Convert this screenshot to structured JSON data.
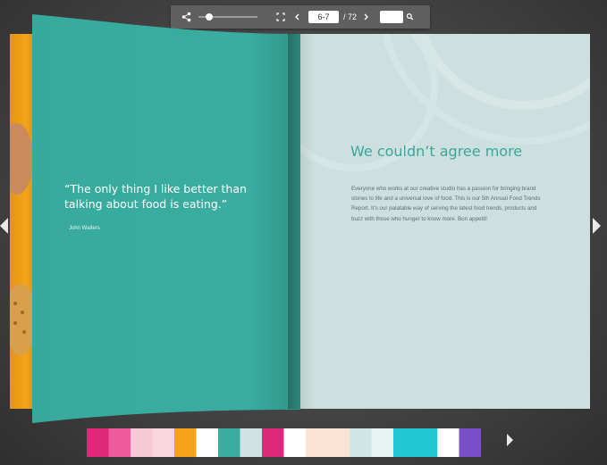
{
  "toolbar": {
    "share_icon": "share-icon",
    "zoom_slider_level": 0.12,
    "fullscreen_icon": "fullscreen-icon",
    "prev_icon": "chevron-left-icon",
    "page_value": "6-7",
    "total_pages": "/ 72",
    "next_icon": "chevron-right-icon",
    "search_value": "",
    "search_icon": "search-icon"
  },
  "left_page": {
    "quote": "“The only thing I like better than talking about food is eating.”",
    "author": "John Walters"
  },
  "right_page": {
    "heading": "We couldn’t agree more",
    "body": "Everyone who works at our creative studio has a passion for bringing brand stories to life and a universal love of food. This is our 5th Annual Food Trends Report. It’s our palatable way of serving the latest food trends, products and buzz with those who hunger to know more. Bon appetit!"
  },
  "colors": {
    "teal": "#3aada1",
    "mint_page": "#cde0df",
    "orange": "#f2a51a",
    "pink": "#e83e8c"
  },
  "thumbnails": [
    {
      "name": "thumb-1",
      "left": "#e0287a",
      "right": "#ee5a9a"
    },
    {
      "name": "thumb-2",
      "left": "#f6c9d6",
      "right": "#f9d6e0"
    },
    {
      "name": "thumb-3",
      "left": "#f3a21a",
      "right": "#ffffff"
    },
    {
      "name": "thumb-4",
      "left": "#39ab9f",
      "right": "#cfe4e2"
    },
    {
      "name": "thumb-5",
      "left": "#e0287a",
      "right": "#ffffff"
    },
    {
      "name": "thumb-6",
      "left": "#fbe3d6",
      "right": "#fbe3d6"
    },
    {
      "name": "thumb-7",
      "left": "#cfe7e4",
      "right": "#e8f4f2"
    },
    {
      "name": "thumb-8",
      "left": "#1fc8d0",
      "right": "#1fc8d0"
    },
    {
      "name": "thumb-9",
      "left": "#ffffff",
      "right": "#7a4fc9"
    }
  ]
}
